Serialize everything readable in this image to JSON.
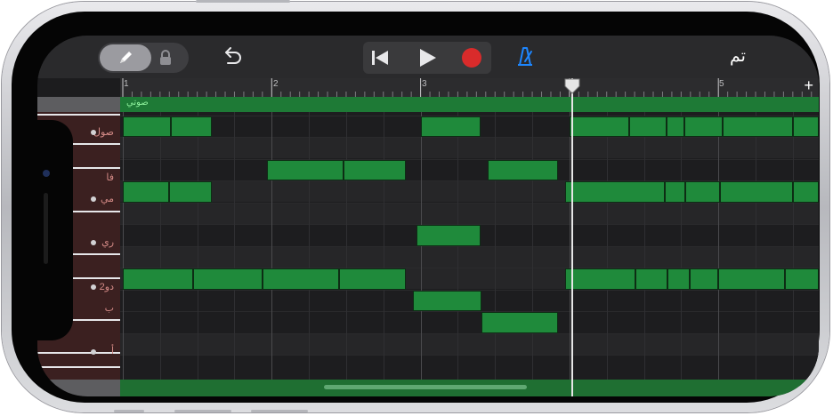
{
  "toolbar": {
    "done_label": "تم",
    "pencil_icon": "pencil-icon",
    "lock_icon": "lock-icon",
    "undo_icon": "undo-icon",
    "go_to_start_icon": "skip-back-icon",
    "play_icon": "play-icon",
    "record_icon": "record-icon",
    "metronome_icon": "metronome-icon",
    "colors": {
      "record": "#d92b2b",
      "metronome": "#1d86ff"
    }
  },
  "ruler": {
    "bars": [
      {
        "label": "1",
        "bar": 1
      },
      {
        "label": "2",
        "bar": 2
      },
      {
        "label": "3",
        "bar": 3
      },
      {
        "label": "4",
        "bar": 4
      },
      {
        "label": "5",
        "bar": 5
      }
    ],
    "add_label": "+",
    "playhead_bar": 4.02
  },
  "region": {
    "name": "صوتي",
    "color": "#1e7a36"
  },
  "keys": [
    {
      "label": "صول",
      "has_dot": true
    },
    {
      "label": "فا",
      "has_dot": false
    },
    {
      "label": "مي",
      "has_dot": true
    },
    {
      "label": "ري",
      "has_dot": true
    },
    {
      "label": "دو2",
      "has_dot": true
    },
    {
      "label": "ب",
      "has_dot": false
    },
    {
      "label": "أ",
      "has_dot": true
    }
  ],
  "notes": [
    {
      "row": 0,
      "start": 1.0,
      "end": 1.32
    },
    {
      "row": 0,
      "start": 1.32,
      "end": 1.6
    },
    {
      "row": 0,
      "start": 3.0,
      "end": 3.4
    },
    {
      "row": 0,
      "start": 4.0,
      "end": 4.4
    },
    {
      "row": 0,
      "start": 4.4,
      "end": 4.65
    },
    {
      "row": 0,
      "start": 4.65,
      "end": 4.77
    },
    {
      "row": 0,
      "start": 4.77,
      "end": 5.03
    },
    {
      "row": 0,
      "start": 5.03,
      "end": 5.5
    },
    {
      "row": 0,
      "start": 5.5,
      "end": 5.68
    },
    {
      "row": 2,
      "start": 1.97,
      "end": 2.48
    },
    {
      "row": 2,
      "start": 2.48,
      "end": 2.9
    },
    {
      "row": 2,
      "start": 3.45,
      "end": 3.92
    },
    {
      "row": 3,
      "start": 1.0,
      "end": 1.31
    },
    {
      "row": 3,
      "start": 1.31,
      "end": 1.6
    },
    {
      "row": 3,
      "start": 3.97,
      "end": 4.64
    },
    {
      "row": 3,
      "start": 4.64,
      "end": 4.78
    },
    {
      "row": 3,
      "start": 4.78,
      "end": 5.01
    },
    {
      "row": 3,
      "start": 5.01,
      "end": 5.5
    },
    {
      "row": 3,
      "start": 5.5,
      "end": 5.68
    },
    {
      "row": 5,
      "start": 2.97,
      "end": 3.4
    },
    {
      "row": 7,
      "start": 1.0,
      "end": 1.47
    },
    {
      "row": 7,
      "start": 1.47,
      "end": 1.94
    },
    {
      "row": 7,
      "start": 1.94,
      "end": 2.45
    },
    {
      "row": 7,
      "start": 2.45,
      "end": 2.9
    },
    {
      "row": 7,
      "start": 3.97,
      "end": 4.44
    },
    {
      "row": 7,
      "start": 4.44,
      "end": 4.66
    },
    {
      "row": 7,
      "start": 4.66,
      "end": 4.81
    },
    {
      "row": 7,
      "start": 4.81,
      "end": 5.0
    },
    {
      "row": 7,
      "start": 5.0,
      "end": 5.45
    },
    {
      "row": 7,
      "start": 5.45,
      "end": 5.68
    },
    {
      "row": 8,
      "start": 2.95,
      "end": 3.41
    },
    {
      "row": 9,
      "start": 3.41,
      "end": 3.92
    }
  ]
}
